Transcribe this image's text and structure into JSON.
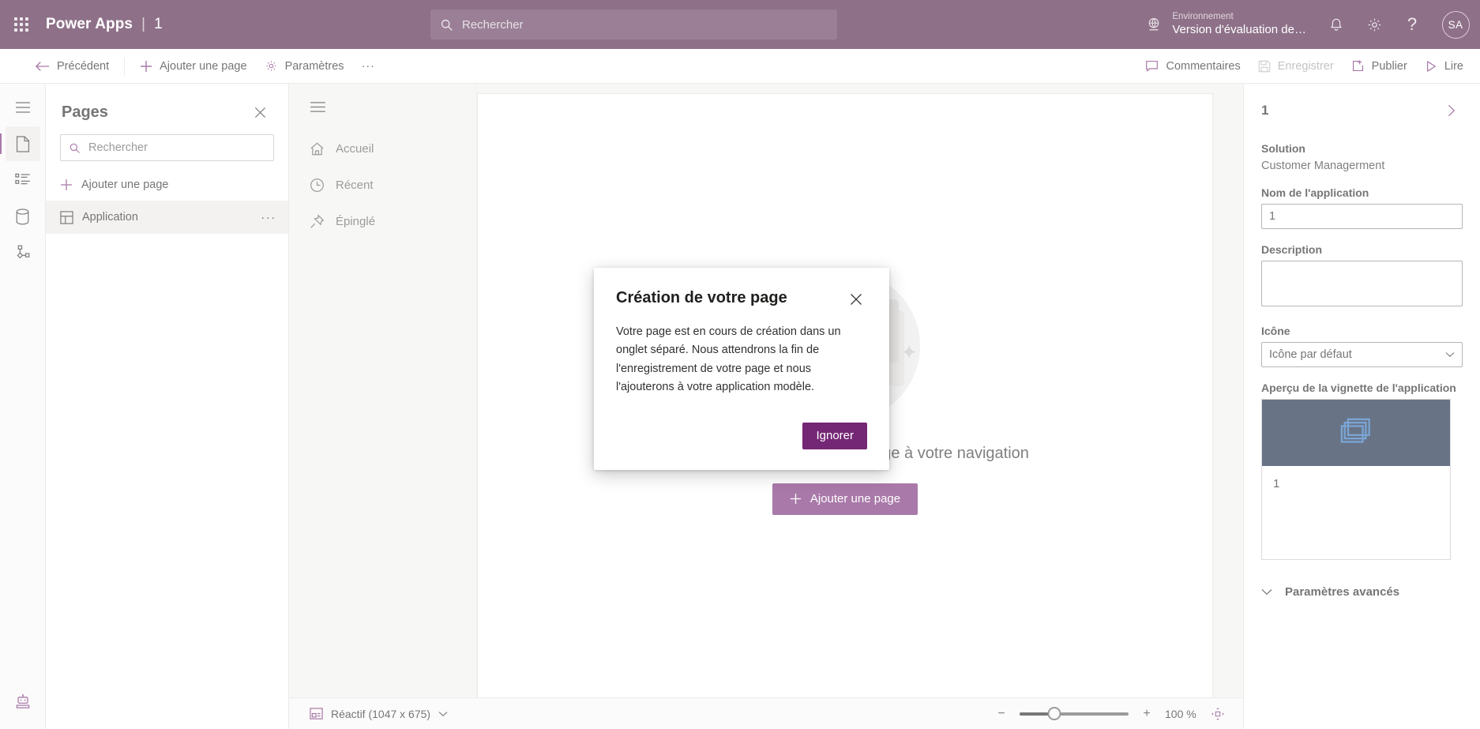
{
  "header": {
    "waffle_name": "app-launcher",
    "product": "Power Apps",
    "separator": "|",
    "app_name": "1",
    "search_placeholder": "Rechercher",
    "environment_label": "Environnement",
    "environment_value": "Version d'évaluation de…",
    "avatar_initials": "SA",
    "bg_color": "#4a1a41"
  },
  "commandbar": {
    "back": "Précédent",
    "add_page": "Ajouter une page",
    "settings": "Paramètres",
    "overflow": "···",
    "comments": "Commentaires",
    "save": "Enregistrer",
    "publish": "Publier",
    "play": "Lire"
  },
  "rail": {
    "items": [
      {
        "name": "menu-icon",
        "label": "Menu"
      },
      {
        "name": "pages-icon",
        "label": "Pages"
      },
      {
        "name": "navigation-icon",
        "label": "Navigation"
      },
      {
        "name": "data-icon",
        "label": "Données"
      },
      {
        "name": "automation-icon",
        "label": "Automatisation"
      }
    ],
    "bottom": {
      "name": "copilot-robot-icon",
      "label": "Copilot"
    }
  },
  "pages": {
    "title": "Pages",
    "close": "✕",
    "search_placeholder": "Rechercher",
    "search_value": "",
    "add_page": "Ajouter une page",
    "items": [
      {
        "label": "Application",
        "selected": true,
        "more": "···"
      }
    ]
  },
  "canvas": {
    "nav": [
      {
        "label": "Accueil",
        "icon": "home-icon"
      },
      {
        "label": "Récent",
        "icon": "clock-icon"
      },
      {
        "label": "Épinglé",
        "icon": "pin-icon"
      }
    ],
    "empty_title": "Commencez par ajouter une page à votre navigation",
    "empty_button": "Ajouter une page"
  },
  "statusbar": {
    "screen_size": "Réactif (1047 x 675)",
    "zoom_minus": "−",
    "zoom_plus": "+",
    "zoom_value": "100 %",
    "fit_label": "Ajuster à l'écran"
  },
  "properties": {
    "title": "1",
    "solution_label": "Solution",
    "solution_value": "Customer Managerment",
    "appname_label": "Nom de l'application",
    "appname_value": "1",
    "description_label": "Description",
    "description_value": "",
    "icon_label": "Icône",
    "icon_value": "Icône par défaut",
    "thumbnail_label": "Aperçu de la vignette de l'application",
    "thumbnail_caption": "1",
    "thumbnail_bg": "#0c1f3d",
    "advanced": "Paramètres avancés"
  },
  "dialog": {
    "title": "Création de votre page",
    "close": "✕",
    "body": "Votre page est en cours de création dans un onglet séparé. Nous attendrons la fin de l'enregistrement de votre page et nous l'ajouterons à votre application modèle.",
    "button": "Ignorer",
    "button_color": "#742774"
  }
}
